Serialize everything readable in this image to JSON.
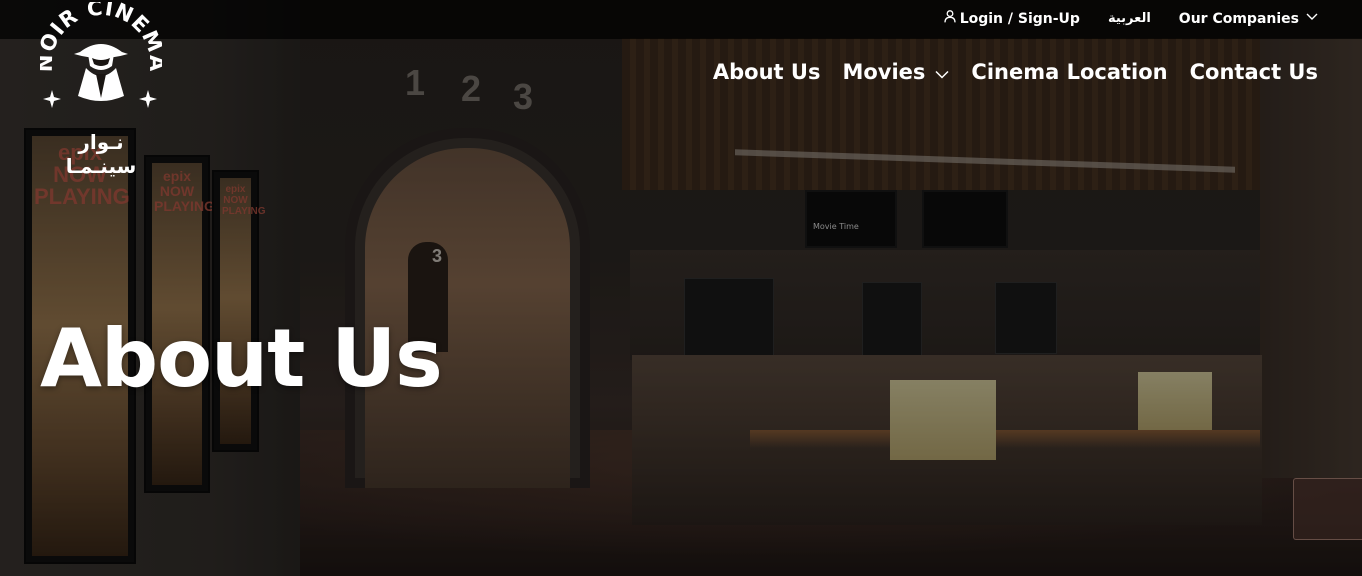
{
  "topbar": {
    "login_label": "Login / Sign-Up",
    "login_icon": "user-icon",
    "language_label": "العربية",
    "companies_label": "Our Companies",
    "companies_icon": "chevron-down-icon"
  },
  "logo": {
    "brand_text": "NOIR CINEMA",
    "arabic_text": "نـوار سينـمـا"
  },
  "nav": {
    "items": [
      {
        "label": "About Us",
        "has_dropdown": false
      },
      {
        "label": "Movies",
        "has_dropdown": true
      },
      {
        "label": "Cinema Location",
        "has_dropdown": false
      },
      {
        "label": "Contact Us",
        "has_dropdown": false
      }
    ]
  },
  "hero": {
    "title": "About Us"
  },
  "scene": {
    "hall_numbers": [
      "1",
      "2",
      "3"
    ],
    "corridor_number": "3",
    "poster_text": [
      "epix NOW PLAYING",
      "epix NOW PLAYING",
      "epix NOW PLAYING"
    ],
    "menu_board_text": "Movie Time"
  },
  "colors": {
    "text": "#ffffff",
    "topbar_bg": "#000000",
    "overlay": "#000000"
  }
}
